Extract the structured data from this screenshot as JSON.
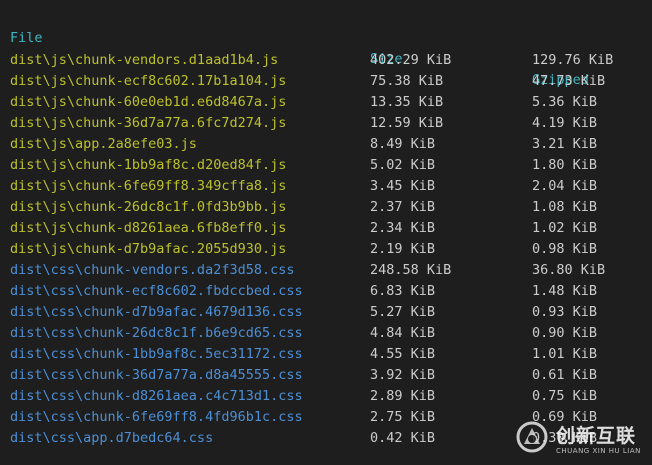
{
  "header": {
    "file": "File",
    "size": "Size",
    "gzipped": "Gzipped"
  },
  "rows": [
    {
      "file": "dist\\js\\chunk-vendors.d1aad1b4.js",
      "size": "402.29 KiB",
      "gzipped": "129.76 KiB",
      "kind": "js"
    },
    {
      "file": "dist\\js\\chunk-ecf8c602.17b1a104.js",
      "size": "75.38 KiB",
      "gzipped": "47.73 KiB",
      "kind": "js"
    },
    {
      "file": "dist\\js\\chunk-60e0eb1d.e6d8467a.js",
      "size": "13.35 KiB",
      "gzipped": "5.36 KiB",
      "kind": "js"
    },
    {
      "file": "dist\\js\\chunk-36d7a77a.6fc7d274.js",
      "size": "12.59 KiB",
      "gzipped": "4.19 KiB",
      "kind": "js"
    },
    {
      "file": "dist\\js\\app.2a8efe03.js",
      "size": "8.49 KiB",
      "gzipped": "3.21 KiB",
      "kind": "js"
    },
    {
      "file": "dist\\js\\chunk-1bb9af8c.d20ed84f.js",
      "size": "5.02 KiB",
      "gzipped": "1.80 KiB",
      "kind": "js"
    },
    {
      "file": "dist\\js\\chunk-6fe69ff8.349cffa8.js",
      "size": "3.45 KiB",
      "gzipped": "2.04 KiB",
      "kind": "js"
    },
    {
      "file": "dist\\js\\chunk-26dc8c1f.0fd3b9bb.js",
      "size": "2.37 KiB",
      "gzipped": "1.08 KiB",
      "kind": "js"
    },
    {
      "file": "dist\\js\\chunk-d8261aea.6fb8eff0.js",
      "size": "2.34 KiB",
      "gzipped": "1.02 KiB",
      "kind": "js"
    },
    {
      "file": "dist\\js\\chunk-d7b9afac.2055d930.js",
      "size": "2.19 KiB",
      "gzipped": "0.98 KiB",
      "kind": "js"
    },
    {
      "file": "dist\\css\\chunk-vendors.da2f3d58.css",
      "size": "248.58 KiB",
      "gzipped": "36.80 KiB",
      "kind": "css"
    },
    {
      "file": "dist\\css\\chunk-ecf8c602.fbdccbed.css",
      "size": "6.83 KiB",
      "gzipped": "1.48 KiB",
      "kind": "css"
    },
    {
      "file": "dist\\css\\chunk-d7b9afac.4679d136.css",
      "size": "5.27 KiB",
      "gzipped": "0.93 KiB",
      "kind": "css"
    },
    {
      "file": "dist\\css\\chunk-26dc8c1f.b6e9cd65.css",
      "size": "4.84 KiB",
      "gzipped": "0.90 KiB",
      "kind": "css"
    },
    {
      "file": "dist\\css\\chunk-1bb9af8c.5ec31172.css",
      "size": "4.55 KiB",
      "gzipped": "1.01 KiB",
      "kind": "css"
    },
    {
      "file": "dist\\css\\chunk-36d7a77a.d8a45555.css",
      "size": "3.92 KiB",
      "gzipped": "0.61 KiB",
      "kind": "css"
    },
    {
      "file": "dist\\css\\chunk-d8261aea.c4c713d1.css",
      "size": "2.89 KiB",
      "gzipped": "0.75 KiB",
      "kind": "css"
    },
    {
      "file": "dist\\css\\chunk-6fe69ff8.4fd96b1c.css",
      "size": "2.75 KiB",
      "gzipped": "0.69 KiB",
      "kind": "css"
    },
    {
      "file": "dist\\css\\app.d7bedc64.css",
      "size": "0.42 KiB",
      "gzipped": "0.30 KiB",
      "kind": "css"
    }
  ],
  "watermark": {
    "text": "创新互联",
    "subtext": "CHUANG XIN HU LIAN",
    "icon": "watermark-logo-icon"
  },
  "colors": {
    "background": "#1e1e1e",
    "header": "#3fb6c1",
    "js_file": "#bcc12a",
    "css_file": "#4c8fd6",
    "size_text": "#cccccc"
  }
}
